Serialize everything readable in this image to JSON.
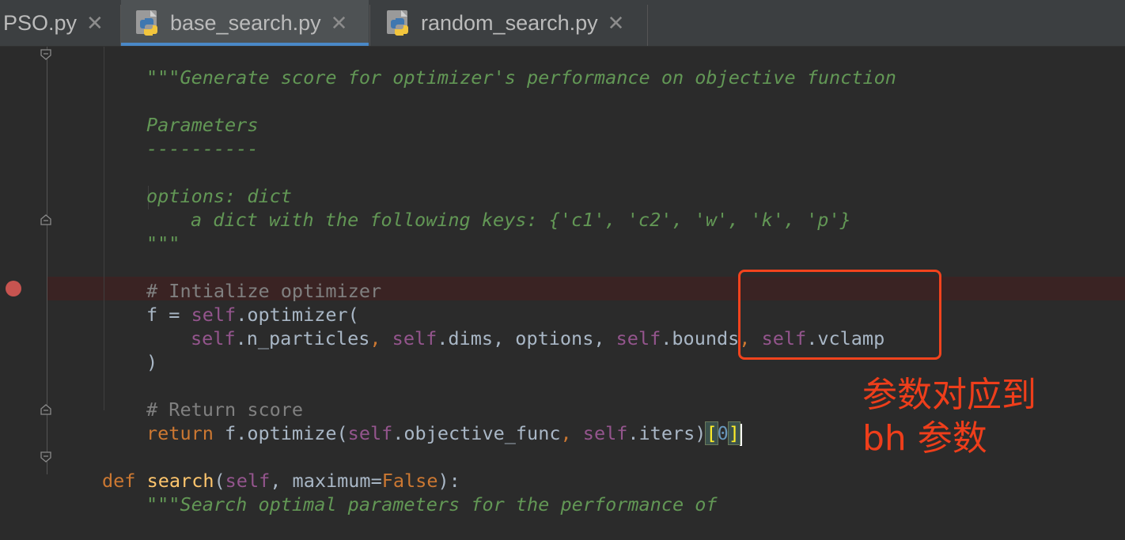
{
  "tabs": [
    {
      "label": "PSO.py",
      "active": false
    },
    {
      "label": "base_search.py",
      "active": true
    },
    {
      "label": "random_search.py",
      "active": false
    }
  ],
  "code": {
    "l1_doc": "\"\"\"Generate score for optimizer's performance on objective function",
    "l2_doc": "Parameters",
    "l3_doc": "----------",
    "l4_doc": "options: dict",
    "l5_doc": "a dict with the following keys: {'c1', 'c2', 'w', 'k', 'p'}",
    "l6_doc": "\"\"\"",
    "l7_comment": "# Intialize optimizer",
    "l8_f": "f = ",
    "l8_self": "self",
    "l8_rest": ".optimizer(",
    "l9_self1": "self",
    "l9_a": ".n_particles",
    "l9_sep1": ", ",
    "l9_self2": "self",
    "l9_b": ".dims",
    "l9_sep2": ", options, ",
    "l9_self3": "self",
    "l9_c": ".bounds",
    "l9_sep3": ", ",
    "l9_self4": "self",
    "l9_d": ".vclamp",
    "l10": ")",
    "l11_comment": "# Return score",
    "l12_return": "return",
    "l12_a": " f.optimize(",
    "l12_self1": "self",
    "l12_b": ".objective_func",
    "l12_sep": ", ",
    "l12_self2": "self",
    "l12_c": ".iters)",
    "l12_lb": "[",
    "l12_idx": "0",
    "l12_rb": "]",
    "l13_def": "def",
    "l13_sp": " ",
    "l13_name": "search",
    "l13_paren": "(",
    "l13_self": "self",
    "l13_params": ", maximum=",
    "l13_false": "False",
    "l13_end": "):",
    "l14_doc": "\"\"\"Search optimal parameters for the performance of"
  },
  "annotation": {
    "line1": "参数对应到",
    "line2": "bh 参数",
    "color": "#ee3e1b"
  },
  "colors": {
    "background": "#2b2b2b",
    "docstring": "#629755",
    "keyword": "#cc7832",
    "self": "#94558d",
    "function_name": "#ffc66d",
    "breakpoint": "#c75450"
  }
}
